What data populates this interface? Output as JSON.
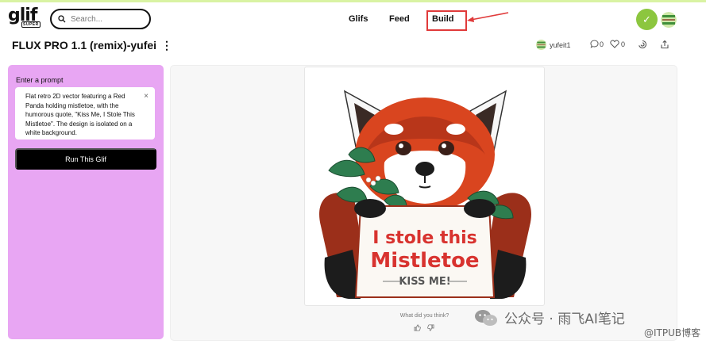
{
  "header": {
    "logo_text": "glif",
    "logo_badge": "SUPER",
    "search_placeholder": "Search...",
    "nav": {
      "glifs": "Glifs",
      "feed": "Feed",
      "build": "Build"
    },
    "status_check": "✓"
  },
  "page": {
    "title": "FLUX PRO 1.1 (remix)-yufei",
    "author": "yufeit1",
    "comments_count": "0",
    "likes_count": "0"
  },
  "prompt_panel": {
    "label": "Enter a prompt",
    "prompt_text": "Flat retro 2D vector featuring a Red Panda holding mistletoe, with the humorous quote, \"Kiss Me, I Stole This Mistletoe\". The design is isolated on a white background.",
    "clear_symbol": "×",
    "run_label": "Run This Glif"
  },
  "output": {
    "sign_line1": "I stole this",
    "sign_line2": "Mistletoe",
    "sign_line3": "KISS ME!",
    "feedback_question": "What did you think?"
  },
  "watermark": {
    "wechat": "公众号 · 雨飞AI笔记",
    "itpub": "@ITPUB博客"
  },
  "colors": {
    "accent_green": "#8cc63f",
    "panel_pink": "#e8a6f3",
    "annotation_red": "#e03a3a",
    "panda_red": "#d9451f",
    "sign_text_red": "#d8332f"
  }
}
